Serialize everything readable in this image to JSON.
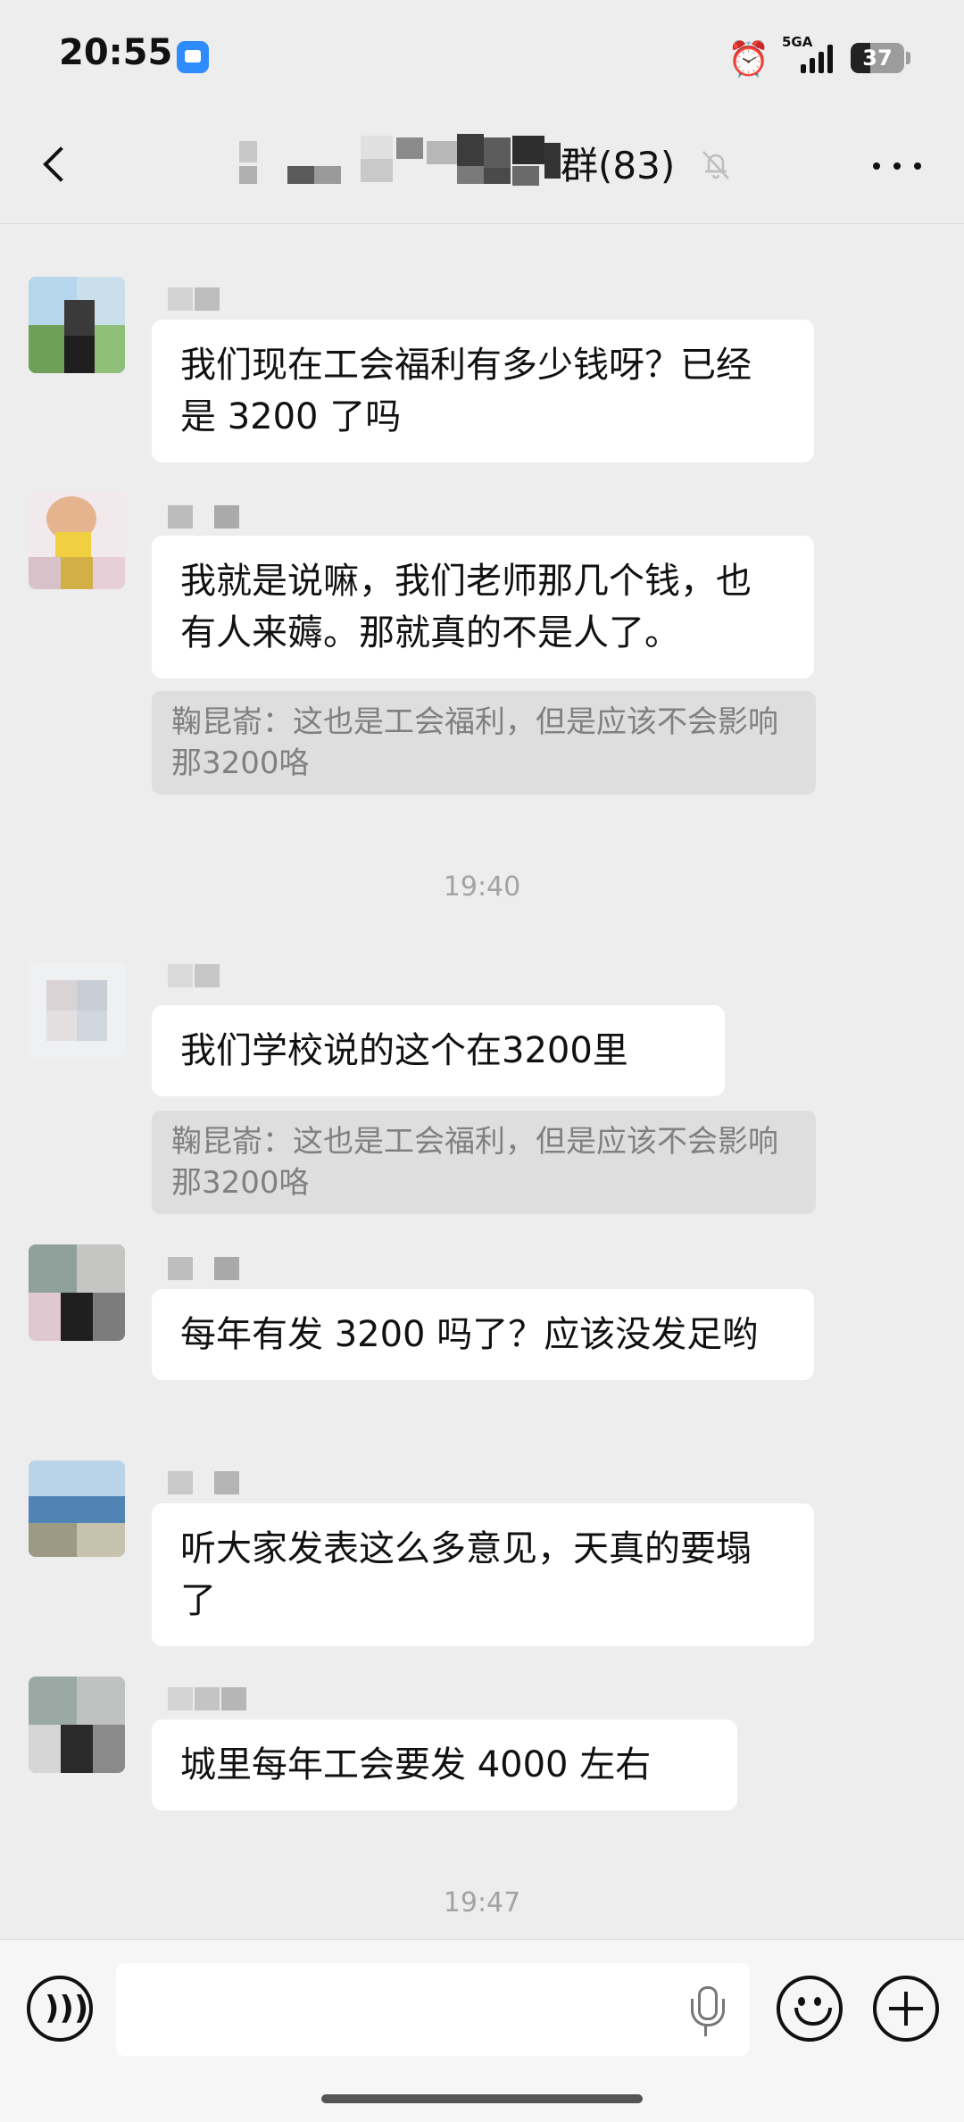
{
  "status_bar": {
    "time": "20:55",
    "network": "5GA",
    "battery": "37",
    "battery_level": 0.37
  },
  "nav": {
    "title": "群(83)"
  },
  "messages": [
    {
      "text": "我们现在工会福利有多少钱呀？已经是 3200 了吗"
    },
    {
      "text": "我就是说嘛，我们老师那几个钱，也有人来薅。那就真的不是人了。",
      "quote": "鞠昆嵛：这也是工会福利，但是应该不会影响那3200咯"
    },
    {
      "text": "我们学校说的这个在3200里",
      "quote": "鞠昆嵛：这也是工会福利，但是应该不会影响那3200咯"
    },
    {
      "text": "每年有发 3200 吗了？应该没发足哟"
    },
    {
      "text": "听大家发表这么多意见，天真的要塌了"
    },
    {
      "text": "城里每年工会要发 4000 左右"
    }
  ],
  "timestamps": [
    "19:40",
    "19:47"
  ],
  "icons": {
    "back": "chevron-left-icon",
    "mute": "bell-off-icon",
    "more": "more-icon",
    "voice": "voice-icon",
    "mic": "mic-icon",
    "emoji": "emoji-icon",
    "plus": "plus-icon"
  },
  "colors": {
    "background": "#ededed",
    "bubble": "#ffffff",
    "quote": "#dedede"
  }
}
